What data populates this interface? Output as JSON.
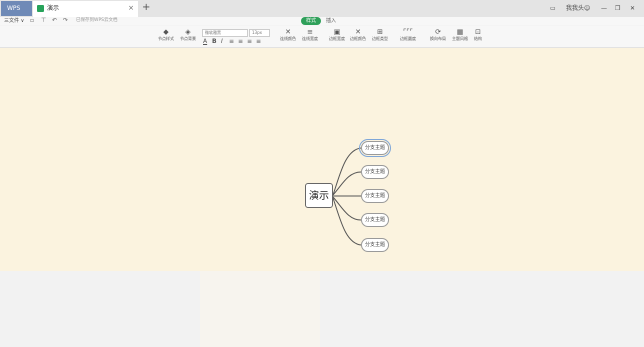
{
  "tabs": {
    "app_label": "WPS",
    "doc_title": "演示",
    "close_glyph": "×",
    "new_tab_glyph": "+"
  },
  "window": {
    "user_label": "我我头"
  },
  "toolbar": {
    "file_menu": "三文件 ∨",
    "sync_tip": "已保存到WPS云文档"
  },
  "mode_tabs": [
    "样式",
    "插入"
  ],
  "ribbon": {
    "buttons": [
      "节点样式",
      "节点背景",
      "连线颜色",
      "连线宽度",
      "边框宽度",
      "边框颜色",
      "边框类型",
      "边框圆度",
      "换向布局",
      "主题风格",
      "结构"
    ],
    "font_name": "微软雅黑",
    "font_size": "13px",
    "format_glyphs": [
      "A",
      "B",
      "I"
    ]
  },
  "mindmap": {
    "central_topic": "演示",
    "subtopics": [
      "分支主题",
      "分支主题",
      "分支主题",
      "分支主题",
      "分支主题"
    ]
  },
  "colors": {
    "canvas": "#fbf3df",
    "accent": "#2fa05a",
    "app_tab": "#6f8ab7"
  }
}
